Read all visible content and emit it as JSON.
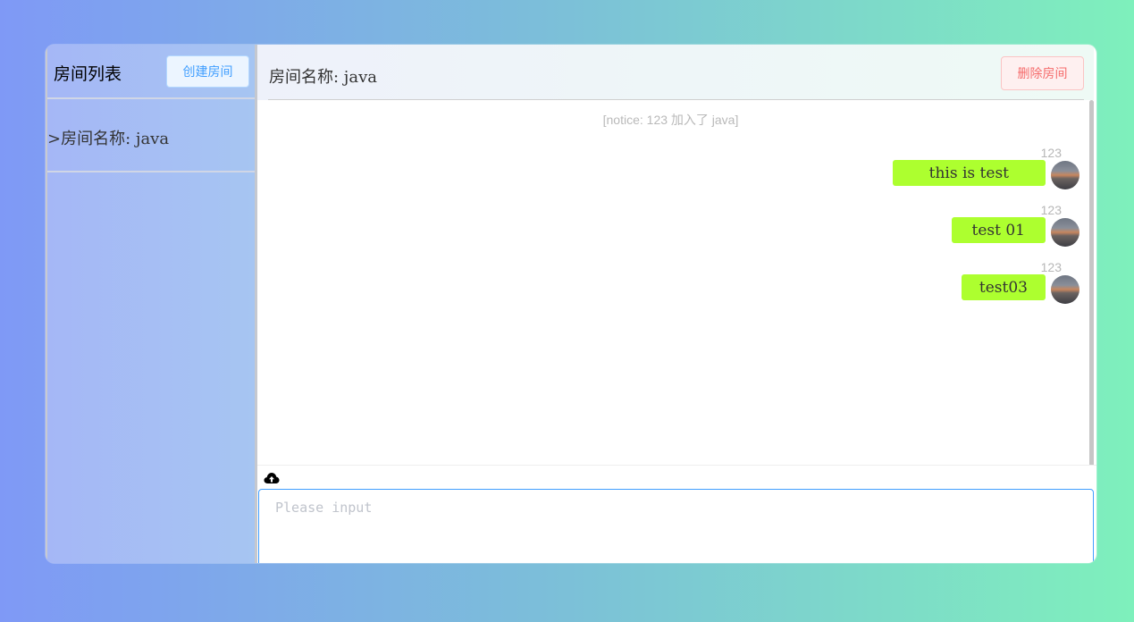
{
  "sidebar": {
    "title": "房间列表",
    "create_button": "创建房间",
    "rooms": [
      {
        "label": ">房间名称: java"
      }
    ]
  },
  "main": {
    "room_title": "房间名称: java",
    "delete_button": "删除房间",
    "notice": "[notice: 123 加入了 java]",
    "messages": [
      {
        "user": "123",
        "text": "this is test"
      },
      {
        "user": "123",
        "text": "test 01"
      },
      {
        "user": "123",
        "text": "test03"
      }
    ],
    "upload_icon": "cloud-upload-icon",
    "input_placeholder": "Please input"
  },
  "colors": {
    "bubble": "#adff2f",
    "primary": "#409eff",
    "danger": "#f56c6c"
  }
}
